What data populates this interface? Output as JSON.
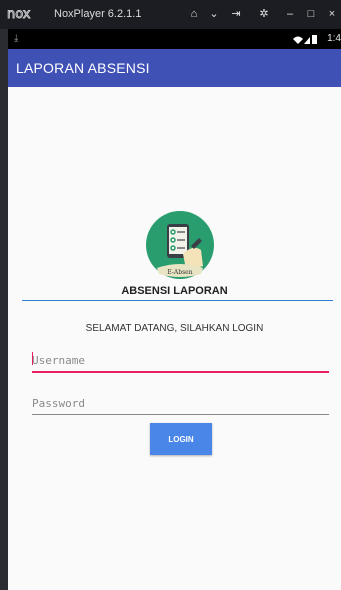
{
  "emulator": {
    "title": "NoxPlayer 6.2.1.1"
  },
  "status": {
    "time": "1:4"
  },
  "app_bar": {
    "title": "LAPORAN ABSENSI"
  },
  "logo": {
    "caption": "E-Absen"
  },
  "app_name": "ABSENSI LAPORAN",
  "welcome": "SELAMAT DATANG, SILAHKAN LOGIN",
  "form": {
    "username_placeholder": "Username",
    "password_placeholder": "Password",
    "login_label": "LOGIN"
  },
  "colors": {
    "app_bar": "#3f51b5",
    "accent": "#e91e63",
    "button": "#4a86e8",
    "logo_bg": "#2a9d6f"
  }
}
